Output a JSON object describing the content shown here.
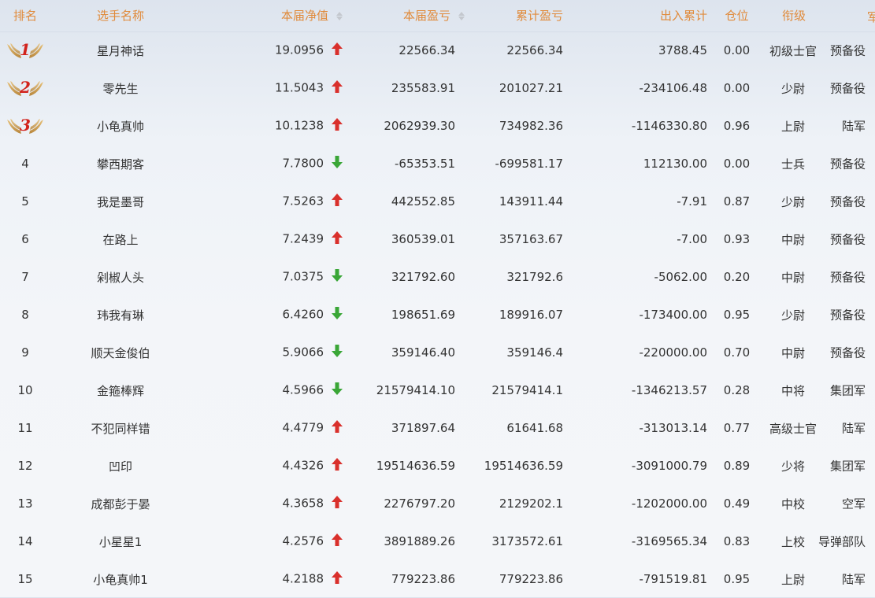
{
  "colors": {
    "header_text": "#e08a3a",
    "up": "#d9302c",
    "down": "#3aa637",
    "rank_number": "#d2231c"
  },
  "headers": {
    "rank": "排名",
    "name": "选手名称",
    "nav": "本届净值",
    "profit": "本届盈亏",
    "cum_profit": "累计盈亏",
    "flow": "出入累计",
    "position": "仓位",
    "grade": "衔级",
    "branch": "军种"
  },
  "rows": [
    {
      "rank": "1",
      "name": "星月神话",
      "nav": "19.0956",
      "trend": "up",
      "profit": "22566.34",
      "cum": "22566.34",
      "flow": "3788.45",
      "pos": "0.00",
      "grade": "初级士官",
      "branch": "预备役"
    },
    {
      "rank": "2",
      "name": "零先生",
      "nav": "11.5043",
      "trend": "up",
      "profit": "235583.91",
      "cum": "201027.21",
      "flow": "-234106.48",
      "pos": "0.00",
      "grade": "少尉",
      "branch": "预备役"
    },
    {
      "rank": "3",
      "name": "小龟真帅",
      "nav": "10.1238",
      "trend": "up",
      "profit": "2062939.30",
      "cum": "734982.36",
      "flow": "-1146330.80",
      "pos": "0.96",
      "grade": "上尉",
      "branch": "陆军"
    },
    {
      "rank": "4",
      "name": "攀西期客",
      "nav": "7.7800",
      "trend": "down",
      "profit": "-65353.51",
      "cum": "-699581.17",
      "flow": "112130.00",
      "pos": "0.00",
      "grade": "士兵",
      "branch": "预备役"
    },
    {
      "rank": "5",
      "name": "我是墨哥",
      "nav": "7.5263",
      "trend": "up",
      "profit": "442552.85",
      "cum": "143911.44",
      "flow": "-7.91",
      "pos": "0.87",
      "grade": "少尉",
      "branch": "预备役"
    },
    {
      "rank": "6",
      "name": "在路上",
      "nav": "7.2439",
      "trend": "up",
      "profit": "360539.01",
      "cum": "357163.67",
      "flow": "-7.00",
      "pos": "0.93",
      "grade": "中尉",
      "branch": "预备役"
    },
    {
      "rank": "7",
      "name": "剁椒人头",
      "nav": "7.0375",
      "trend": "down",
      "profit": "321792.60",
      "cum": "321792.6",
      "flow": "-5062.00",
      "pos": "0.20",
      "grade": "中尉",
      "branch": "预备役"
    },
    {
      "rank": "8",
      "name": "玮我有琳",
      "nav": "6.4260",
      "trend": "down",
      "profit": "198651.69",
      "cum": "189916.07",
      "flow": "-173400.00",
      "pos": "0.95",
      "grade": "少尉",
      "branch": "预备役"
    },
    {
      "rank": "9",
      "name": "顺天金俊伯",
      "nav": "5.9066",
      "trend": "down",
      "profit": "359146.40",
      "cum": "359146.4",
      "flow": "-220000.00",
      "pos": "0.70",
      "grade": "中尉",
      "branch": "预备役"
    },
    {
      "rank": "10",
      "name": "金箍棒辉",
      "nav": "4.5966",
      "trend": "down",
      "profit": "21579414.10",
      "cum": "21579414.1",
      "flow": "-1346213.57",
      "pos": "0.28",
      "grade": "中将",
      "branch": "集团军"
    },
    {
      "rank": "11",
      "name": "不犯同样错",
      "nav": "4.4779",
      "trend": "up",
      "profit": "371897.64",
      "cum": "61641.68",
      "flow": "-313013.14",
      "pos": "0.77",
      "grade": "高级士官",
      "branch": "陆军"
    },
    {
      "rank": "12",
      "name": "凹印",
      "nav": "4.4326",
      "trend": "up",
      "profit": "19514636.59",
      "cum": "19514636.59",
      "flow": "-3091000.79",
      "pos": "0.89",
      "grade": "少将",
      "branch": "集团军"
    },
    {
      "rank": "13",
      "name": "成都彭于晏",
      "nav": "4.3658",
      "trend": "up",
      "profit": "2276797.20",
      "cum": "2129202.1",
      "flow": "-1202000.00",
      "pos": "0.49",
      "grade": "中校",
      "branch": "空军"
    },
    {
      "rank": "14",
      "name": "小星星1",
      "nav": "4.2576",
      "trend": "up",
      "profit": "3891889.26",
      "cum": "3173572.61",
      "flow": "-3169565.34",
      "pos": "0.83",
      "grade": "上校",
      "branch": "导弹部队"
    },
    {
      "rank": "15",
      "name": "小龟真帅1",
      "nav": "4.2188",
      "trend": "up",
      "profit": "779223.86",
      "cum": "779223.86",
      "flow": "-791519.81",
      "pos": "0.95",
      "grade": "上尉",
      "branch": "陆军"
    }
  ]
}
